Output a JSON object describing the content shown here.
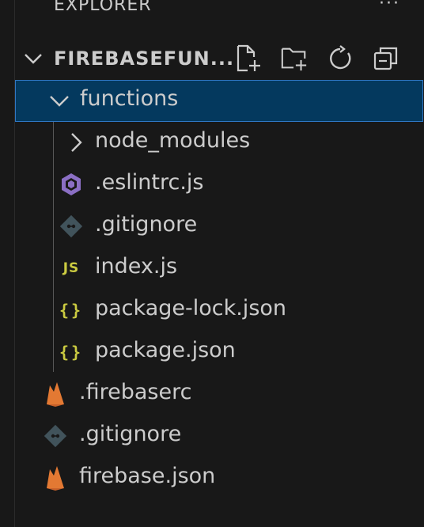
{
  "panel": {
    "title": "EXPLORER",
    "more_actions": "···"
  },
  "section": {
    "title": "FIREBASEFUN...",
    "actions": [
      "new-file-icon",
      "new-folder-icon",
      "refresh-icon",
      "collapse-all-icon"
    ]
  },
  "tree": {
    "functions": {
      "label": "functions",
      "icon": "chevron-down-icon",
      "expanded": true,
      "selected": true
    },
    "node_modules": {
      "label": "node_modules",
      "icon": "chevron-right-icon"
    },
    "eslintrc": {
      "label": ".eslintrc.js",
      "icon": "eslint-icon",
      "color": "#8b6fc4"
    },
    "gitignore_inner": {
      "label": ".gitignore",
      "icon": "git-icon",
      "color": "#41535b"
    },
    "index_js": {
      "label": "index.js",
      "icon": "js-icon",
      "icon_text": "JS",
      "color": "#cbcb41"
    },
    "package_lock": {
      "label": "package-lock.json",
      "icon": "json-icon",
      "icon_text": "{}",
      "color": "#cbcb41"
    },
    "package_json": {
      "label": "package.json",
      "icon": "json-icon",
      "icon_text": "{}",
      "color": "#cbcb41"
    },
    "firebaserc": {
      "label": ".firebaserc",
      "icon": "firebase-icon",
      "color": "#e37933"
    },
    "gitignore_root": {
      "label": ".gitignore",
      "icon": "git-icon",
      "color": "#41535b"
    },
    "firebase_json": {
      "label": "firebase.json",
      "icon": "firebase-icon",
      "color": "#e37933"
    }
  },
  "colors": {
    "background": "#181818",
    "selection": "#04395e",
    "selection_border": "#2f77c4",
    "text": "#cccccc"
  }
}
